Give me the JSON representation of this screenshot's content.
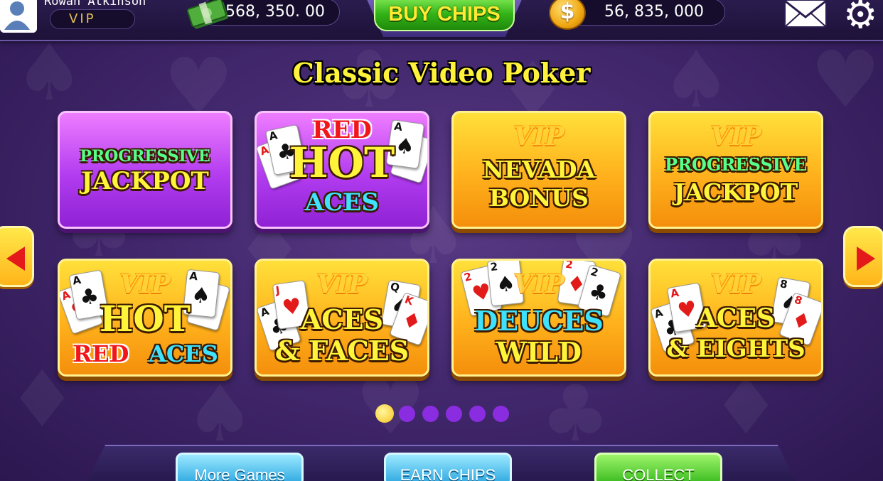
{
  "header": {
    "username": "Rowan Atkinson",
    "status": "VIP",
    "cash_balance": "568, 350. 00",
    "buy_chips_label": "BUY CHIPS",
    "coin_balance": "56, 835, 000",
    "coin_symbol": "$"
  },
  "title": "Classic Video Poker",
  "games": [
    {
      "line1": "PROGRESSIVE",
      "line2": "JACKPOT"
    },
    {
      "line1": "RED",
      "line2": "HOT",
      "line3": "ACES"
    },
    {
      "vip": "VIP",
      "line1": "NEVADA",
      "line2": "BONUS"
    },
    {
      "vip": "VIP",
      "line1": "PROGRESSIVE",
      "line2": "JACKPOT"
    },
    {
      "vip": "VIP",
      "line1": "HOT",
      "line2": "RED",
      "line3": "ACES"
    },
    {
      "vip": "VIP",
      "line1": "ACES",
      "line2": "& FACES"
    },
    {
      "vip": "VIP",
      "line1": "DEUCES",
      "line2": "WILD"
    },
    {
      "vip": "VIP",
      "line1": "ACES",
      "line2": "& EIGHTS"
    }
  ],
  "pagination": {
    "total": 6,
    "active": 1
  },
  "footer": {
    "more_games": "More Games",
    "earn_chips": "EARN CHIPS",
    "collect": "COLLECT"
  },
  "card_ranks": {
    "ace": "A",
    "two": "2",
    "jack": "J",
    "queen": "Q",
    "king": "K",
    "eight": "8"
  },
  "icons": [
    "avatar-icon",
    "cash-icon",
    "coin-icon",
    "mail-icon",
    "gear-icon",
    "arrow-left-icon",
    "arrow-right-icon"
  ],
  "colors": {
    "purple_tile": "#b23cf0",
    "gold_tile": "#ffb11c",
    "title_yellow": "#fff23a",
    "buy_green": "#33b318"
  }
}
